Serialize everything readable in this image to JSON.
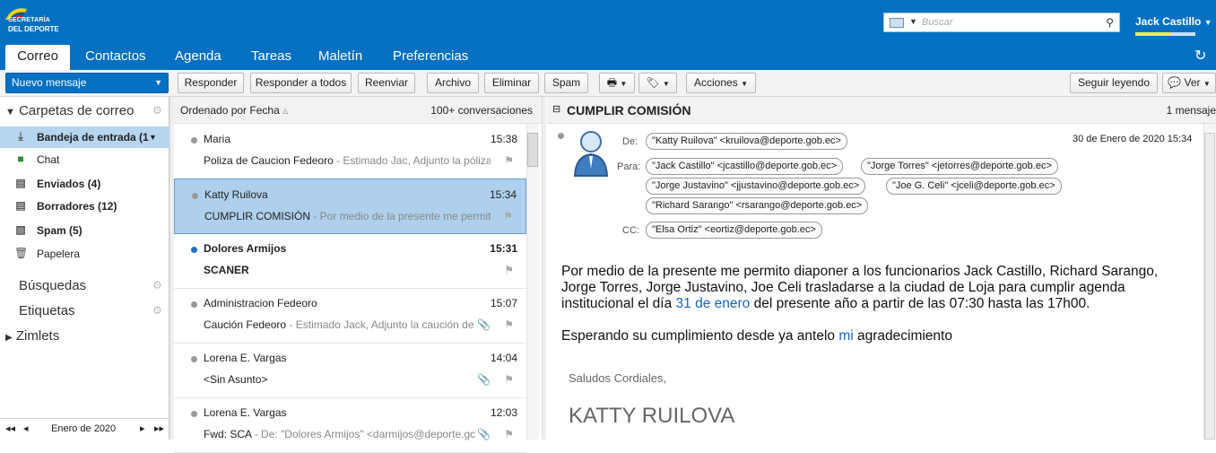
{
  "logo": {
    "line1": "SECRETARÍA",
    "line2": "DEL DEPORTE"
  },
  "search": {
    "placeholder": "Buscar"
  },
  "user": {
    "name": "Jack Castillo"
  },
  "tabs": [
    "Correo",
    "Contactos",
    "Agenda",
    "Tareas",
    "Maletín",
    "Preferencias"
  ],
  "toolbar": {
    "new": "Nuevo mensaje",
    "reply": "Responder",
    "reply_all": "Responder a todos",
    "forward": "Reenviar",
    "archive": "Archivo",
    "delete": "Eliminar",
    "spam": "Spam",
    "actions": "Acciones",
    "keep_reading": "Seguir leyendo",
    "view": "Ver"
  },
  "sidebar": {
    "mail_folders": "Carpetas de correo",
    "folders": [
      {
        "label": "Bandeja de entrada (1",
        "bold": true
      },
      {
        "label": "Chat",
        "bold": false
      },
      {
        "label": "Enviados (4)",
        "bold": true
      },
      {
        "label": "Borradores (12)",
        "bold": true
      },
      {
        "label": "Spam (5)",
        "bold": true
      },
      {
        "label": "Papelera",
        "bold": false
      }
    ],
    "searches": "Búsquedas",
    "tags": "Etiquetas",
    "zimlets": "Zimlets",
    "calendar_month": "Enero de 2020"
  },
  "list": {
    "sort": "Ordenado por Fecha",
    "count": "100+ conversaciones",
    "items": [
      {
        "from": "Maria",
        "time": "15:38",
        "subject": "Poliza de Caucion Fedeoro",
        "fragment": " - Estimado Jac, Adjunto la póliza d",
        "unread": false,
        "attach": false
      },
      {
        "from": "Katty Ruilova",
        "time": "15:34",
        "subject": "CUMPLIR COMISIÓN",
        "fragment": " - Por medio de la presente me permito d",
        "unread": false,
        "attach": false
      },
      {
        "from": "Dolores Armijos",
        "time": "15:31",
        "subject": "SCANER",
        "fragment": "",
        "unread": true,
        "attach": false
      },
      {
        "from": "Administracion Fedeoro",
        "time": "15:07",
        "subject": "Caución Fedeoro",
        "fragment": " - Estimado Jack, Adjunto la caución de",
        "unread": false,
        "attach": true
      },
      {
        "from": "Lorena E. Vargas",
        "time": "14:04",
        "subject": "<Sin Asunto>",
        "fragment": "",
        "unread": false,
        "attach": true
      },
      {
        "from": "Lorena E. Vargas",
        "time": "12:03",
        "subject": "Fwd: SCA",
        "fragment": " - De: \"Dolores Armijos\" <darmijos@deporte.gc",
        "unread": false,
        "attach": true
      }
    ]
  },
  "message": {
    "title": "CUMPLIR COMISIÓN",
    "count": "1 mensaje",
    "from_label": "De:",
    "to_label": "Para:",
    "cc_label": "CC:",
    "date": "30 de Enero de 2020 15:34",
    "from": "\"Katty Ruilova\" <kruilova@deporte.gob.ec>",
    "to": [
      "\"Jack Castillo\" <jcastillo@deporte.gob.ec>",
      "\"Jorge Torres\" <jetorres@deporte.gob.ec>",
      "\"Jorge Justavino\" <jjustavino@deporte.gob.ec>",
      "\"Joe G. Celi\" <jceli@deporte.gob.ec>",
      "\"Richard Sarango\" <rsarango@deporte.gob.ec>"
    ],
    "cc": "\"Elsa Ortiz\" <eortiz@deporte.gob.ec>",
    "p1a": "Por medio de la presente me permito diaponer a los funcionarios Jack Castillo, Richard Sarango,",
    "p1b": "Jorge Torres, Jorge Justavino, Joe Celi trasladarse a la ciudad de Loja para cumplir agenda",
    "p1c_pre": "institucional el día ",
    "p1c_link": "31 de enero",
    "p1c_post": " del presente año a partir de las 07:30 hasta las 17h00.",
    "p2_pre": "Esperando su cumplimiento desde ya antelo ",
    "p2_link": "mi",
    "p2_post": " agradecimiento",
    "greeting": "Saludos Cordiales,",
    "signature": "KATTY RUILOVA"
  }
}
